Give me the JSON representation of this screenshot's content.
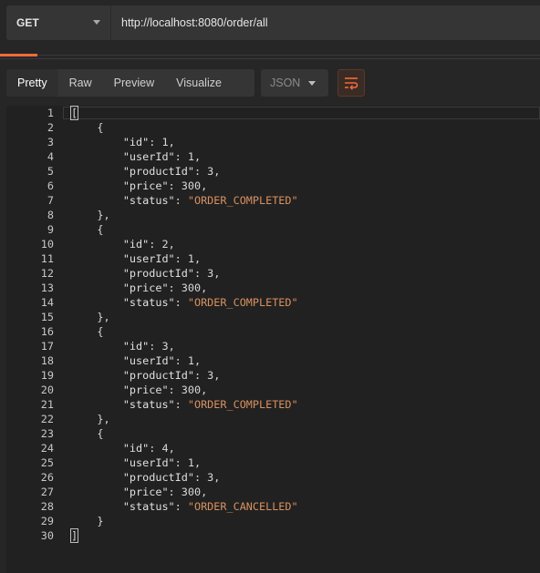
{
  "request": {
    "method": "GET",
    "url": "http://localhost:8080/order/all"
  },
  "response_toolbar": {
    "views": [
      "Pretty",
      "Raw",
      "Preview",
      "Visualize"
    ],
    "active_view": "Pretty",
    "format": "JSON",
    "wrap_icon": "wrap-lines-icon"
  },
  "colors": {
    "accent": "#f26b3a",
    "string": "#d9905f"
  },
  "body_lines": [
    {
      "n": "1",
      "t": "["
    },
    {
      "n": "2",
      "t": "    {"
    },
    {
      "n": "3",
      "t": "        \"id\": 1,"
    },
    {
      "n": "4",
      "t": "        \"userId\": 1,"
    },
    {
      "n": "5",
      "t": "        \"productId\": 3,"
    },
    {
      "n": "6",
      "t": "        \"price\": 300,"
    },
    {
      "n": "7",
      "t": "        \"status\": \"ORDER_COMPLETED\""
    },
    {
      "n": "8",
      "t": "    },"
    },
    {
      "n": "9",
      "t": "    {"
    },
    {
      "n": "10",
      "t": "        \"id\": 2,"
    },
    {
      "n": "11",
      "t": "        \"userId\": 1,"
    },
    {
      "n": "12",
      "t": "        \"productId\": 3,"
    },
    {
      "n": "13",
      "t": "        \"price\": 300,"
    },
    {
      "n": "14",
      "t": "        \"status\": \"ORDER_COMPLETED\""
    },
    {
      "n": "15",
      "t": "    },"
    },
    {
      "n": "16",
      "t": "    {"
    },
    {
      "n": "17",
      "t": "        \"id\": 3,"
    },
    {
      "n": "18",
      "t": "        \"userId\": 1,"
    },
    {
      "n": "19",
      "t": "        \"productId\": 3,"
    },
    {
      "n": "20",
      "t": "        \"price\": 300,"
    },
    {
      "n": "21",
      "t": "        \"status\": \"ORDER_COMPLETED\""
    },
    {
      "n": "22",
      "t": "    },"
    },
    {
      "n": "23",
      "t": "    {"
    },
    {
      "n": "24",
      "t": "        \"id\": 4,"
    },
    {
      "n": "25",
      "t": "        \"userId\": 1,"
    },
    {
      "n": "26",
      "t": "        \"productId\": 3,"
    },
    {
      "n": "27",
      "t": "        \"price\": 300,"
    },
    {
      "n": "28",
      "t": "        \"status\": \"ORDER_CANCELLED\""
    },
    {
      "n": "29",
      "t": "    }"
    },
    {
      "n": "30",
      "t": "]"
    }
  ]
}
